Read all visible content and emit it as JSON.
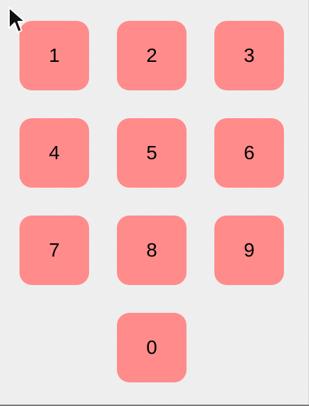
{
  "keypad": {
    "keys": [
      "1",
      "2",
      "3",
      "4",
      "5",
      "6",
      "7",
      "8",
      "9",
      "0"
    ]
  },
  "colors": {
    "background": "#f0f0f0",
    "key_fill": "#ff8b8b",
    "key_text": "#000000"
  },
  "icons": {
    "cursor": "mouse-pointer-icon"
  }
}
